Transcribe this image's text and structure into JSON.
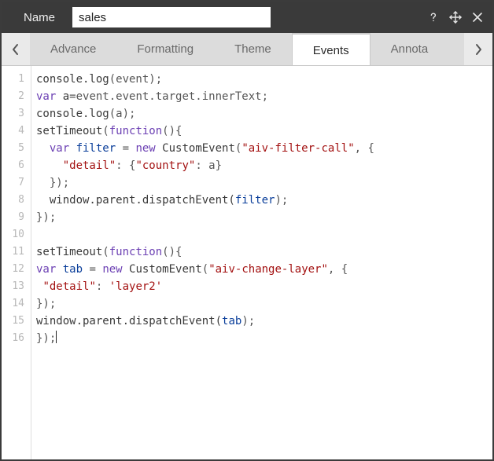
{
  "titlebar": {
    "label": "Name",
    "name_value": "sales"
  },
  "tabs": {
    "items": [
      {
        "label": "Advance",
        "active": false
      },
      {
        "label": "Formatting",
        "active": false
      },
      {
        "label": "Theme",
        "active": false
      },
      {
        "label": "Events",
        "active": true
      },
      {
        "label": "Annota",
        "active": false
      }
    ]
  },
  "editor": {
    "line_numbers": [
      "1",
      "2",
      "3",
      "4",
      "5",
      "6",
      "7",
      "8",
      "9",
      "10",
      "11",
      "12",
      "13",
      "14",
      "15",
      "16"
    ],
    "lines": [
      [
        {
          "t": "console.log",
          "c": "call"
        },
        {
          "t": "(event);",
          "c": "punc"
        }
      ],
      [
        {
          "t": "var ",
          "c": "kw"
        },
        {
          "t": "a",
          "c": "id"
        },
        {
          "t": "=event.event.target.innerText;",
          "c": "punc"
        }
      ],
      [
        {
          "t": "console.log",
          "c": "call"
        },
        {
          "t": "(a);",
          "c": "punc"
        }
      ],
      [
        {
          "t": "setTimeout",
          "c": "call"
        },
        {
          "t": "(",
          "c": "punc"
        },
        {
          "t": "function",
          "c": "fn"
        },
        {
          "t": "(){",
          "c": "punc"
        }
      ],
      [
        {
          "t": "  ",
          "c": "punc"
        },
        {
          "t": "var ",
          "c": "kw"
        },
        {
          "t": "filter",
          "c": "var"
        },
        {
          "t": " = ",
          "c": "punc"
        },
        {
          "t": "new ",
          "c": "kw"
        },
        {
          "t": "CustomEvent",
          "c": "call"
        },
        {
          "t": "(",
          "c": "punc"
        },
        {
          "t": "\"aiv-filter-call\"",
          "c": "str"
        },
        {
          "t": ", {",
          "c": "punc"
        }
      ],
      [
        {
          "t": "    ",
          "c": "punc"
        },
        {
          "t": "\"detail\"",
          "c": "key"
        },
        {
          "t": ": {",
          "c": "punc"
        },
        {
          "t": "\"country\"",
          "c": "key"
        },
        {
          "t": ": a}",
          "c": "punc"
        }
      ],
      [
        {
          "t": "  });",
          "c": "punc"
        }
      ],
      [
        {
          "t": "  window.parent.dispatchEvent(",
          "c": "call"
        },
        {
          "t": "filter",
          "c": "var"
        },
        {
          "t": ");",
          "c": "punc"
        }
      ],
      [
        {
          "t": "});",
          "c": "punc"
        }
      ],
      [],
      [
        {
          "t": "setTimeout",
          "c": "call"
        },
        {
          "t": "(",
          "c": "punc"
        },
        {
          "t": "function",
          "c": "fn"
        },
        {
          "t": "(){",
          "c": "punc"
        }
      ],
      [
        {
          "t": "var ",
          "c": "kw"
        },
        {
          "t": "tab",
          "c": "var"
        },
        {
          "t": " = ",
          "c": "punc"
        },
        {
          "t": "new ",
          "c": "kw"
        },
        {
          "t": "CustomEvent",
          "c": "call"
        },
        {
          "t": "(",
          "c": "punc"
        },
        {
          "t": "\"aiv-change-layer\"",
          "c": "str"
        },
        {
          "t": ", {",
          "c": "punc"
        }
      ],
      [
        {
          "t": " ",
          "c": "punc"
        },
        {
          "t": "\"detail\"",
          "c": "key"
        },
        {
          "t": ": ",
          "c": "punc"
        },
        {
          "t": "'layer2'",
          "c": "str"
        }
      ],
      [
        {
          "t": "});",
          "c": "punc"
        }
      ],
      [
        {
          "t": "window.parent.dispatchEvent(",
          "c": "call"
        },
        {
          "t": "tab",
          "c": "var"
        },
        {
          "t": ");",
          "c": "punc"
        }
      ],
      [
        {
          "t": "});",
          "c": "punc"
        }
      ]
    ],
    "cursor_line_index": 15
  }
}
